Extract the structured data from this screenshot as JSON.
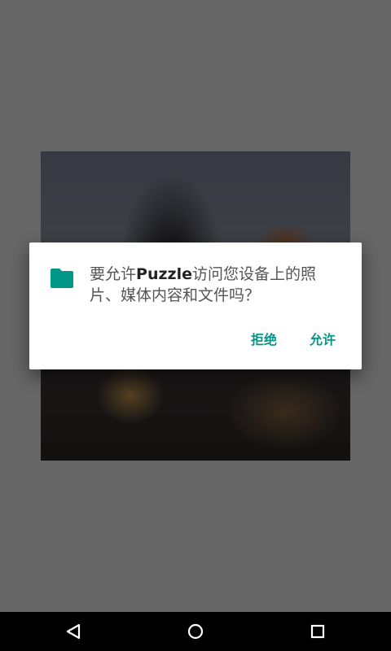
{
  "dialog": {
    "message_before": "要允许",
    "app_name": "Puzzle",
    "message_after": "访问您设备上的照片、媒体内容和文件吗？",
    "deny_label": "拒绝",
    "allow_label": "允许",
    "icon": "folder-icon"
  },
  "navigation_bar": {
    "back_icon": "back-icon",
    "home_icon": "home-icon",
    "recents_icon": "recents-icon"
  },
  "colors": {
    "accent": "#009688",
    "scrim": "#676767",
    "navbar": "#000000"
  }
}
